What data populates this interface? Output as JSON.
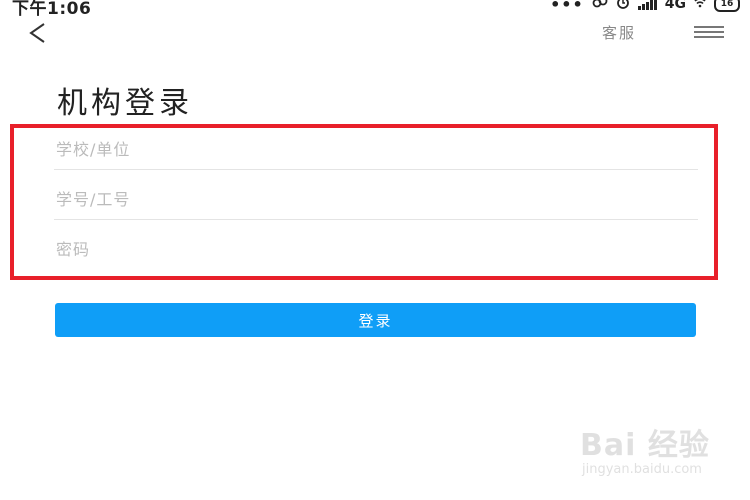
{
  "status_bar": {
    "time": "下午1:06",
    "network": "4G",
    "battery": "16"
  },
  "nav": {
    "service_label": "客服"
  },
  "page": {
    "title": "机构登录"
  },
  "form": {
    "school_placeholder": "学校/单位",
    "id_placeholder": "学号/工号",
    "password_placeholder": "密码"
  },
  "actions": {
    "login_label": "登录"
  },
  "watermark": {
    "brand": "Bai 经验",
    "url": "jingyan.baidu.com"
  },
  "colors": {
    "primary": "#0f9ef7",
    "highlight_border": "#e8202a"
  },
  "icons": {
    "back": "chevron-left-icon",
    "menu": "menu-icon"
  }
}
